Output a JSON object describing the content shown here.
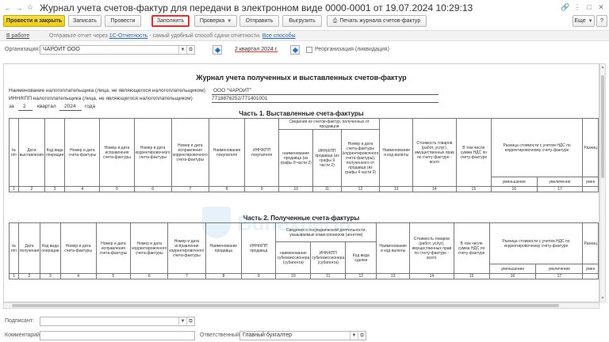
{
  "window": {
    "title": "Журнал учета счетов-фактур для передачи в электронном виде 0000-0001 от 19.07.2024 10:29:13"
  },
  "toolbar": {
    "post_close": "Провести и закрыть",
    "save": "Записать",
    "post": "Провести",
    "fill": "Заполнить",
    "check": "Проверка",
    "send": "Отправить",
    "export": "Выгрузить",
    "print": "Печать журнала счетов-фактур",
    "more": "Еще",
    "help": "?"
  },
  "infobar": {
    "status": "В работе",
    "text1": "Отправьте отчет через",
    "link1": "1С-Отчетность",
    "text2": "- самый удобный способ сдачи отчетности.",
    "link2": "Все способы"
  },
  "org": {
    "label": "Организация:",
    "value": "ЧАРОИТ ООО",
    "period": "2 квартал 2024 г.",
    "reorg_label": "Реорганизация (ликвидация)"
  },
  "report": {
    "title": "Журнал учета полученных и выставленных счетов-фактур",
    "taxpayer_label": "Наименование налогоплательщика (лица, не являющегося налогоплательщиком)",
    "taxpayer_value": "ООО \"ЧАРОИТ\"",
    "inn_label": "ИНН/КПП налогоплательщика (лица, не являющегося налогоплательщиком)",
    "inn_value": "7718876252/771401001",
    "period_prefix": "за",
    "quarter": "2",
    "quarter_word": "квартал",
    "year": "2024",
    "year_word": "года",
    "part1": "Часть 1. Выставленные счета-фактуры",
    "part2": "Часть 2. Полученные счета-фактуры",
    "p1": {
      "h": [
        "№ п/п",
        "Дата выставления",
        "Код вида операции",
        "Номер и дата счета-фактуры",
        "Номер и дата исправления счета-фактуры",
        "Номер и дата корректировочного счета-фактуры",
        "Номер и дата исправления корректировочного счета-фактуры",
        "Наименование покупателя",
        "ИНН/КПП покупателя",
        "Сведения из счетов-фактур, полученных от продавцов",
        "наименование продавца (из графы 8 части 2)",
        "ИНН/КПП продавца (из графы 9 части 2)",
        "Номер и дата счета-фактуры (корректировочного счета-фактуры), полученного от продавца (из графы 4 части 2)",
        "Наименование и код валюты",
        "Стоимость товаров (работ, услуг), имущественных прав по счету-фактуре - всего",
        "В том числе сумма НДС по счету-фактуре",
        "Разница стоимости с учетом НДС по корректировочному счету-фактуре",
        "уменьшение",
        "увеличение",
        "Разниц",
        "умен"
      ],
      "nums": [
        "1",
        "2",
        "3",
        "4",
        "5",
        "6",
        "7",
        "8",
        "9",
        "10",
        "11",
        "12",
        "13",
        "14",
        "15",
        "16",
        "17",
        ""
      ]
    },
    "p2": {
      "h": [
        "№ п/п",
        "Дата получения",
        "Код вида операции",
        "Номер и дата счета-фактуры",
        "Номер и дата исправления счета-фактуры",
        "Номер и дата корректировочного счета-фактуры",
        "Номер и дата исправления корректировочного счета-фактуры",
        "Наименование продавца",
        "ИНН/КПП продавца",
        "Сведения о посреднической деятельности, указываемые комиссионером (агентом)",
        "наименование субкомиссионера (субагента)",
        "ИНН/КПП субкомиссионера (субагента)",
        "Код вида сделки",
        "Наименование и код валюты",
        "Стоимость товаров (работ, услуг), имущественных прав по счету-фактуре - всего",
        "В том числе сумма НДС по счету-фактуре",
        "Разница стоимости с учетом НДС по корректировочному счету-фактуре",
        "уменьшение",
        "увеличение",
        "Разниц",
        "умен"
      ],
      "nums": [
        "1",
        "2",
        "3",
        "4",
        "5",
        "6",
        "7",
        "8",
        "9",
        "10",
        "11",
        "12",
        "13",
        "14",
        "15",
        "16",
        "17",
        ""
      ]
    }
  },
  "footer": {
    "signer_label": "Подписант:",
    "signer_value": "",
    "comment_label": "Комментарий:",
    "comment_value": "",
    "responsible_label": "Ответственный:",
    "responsible_value": "Главный бухгалтер"
  }
}
